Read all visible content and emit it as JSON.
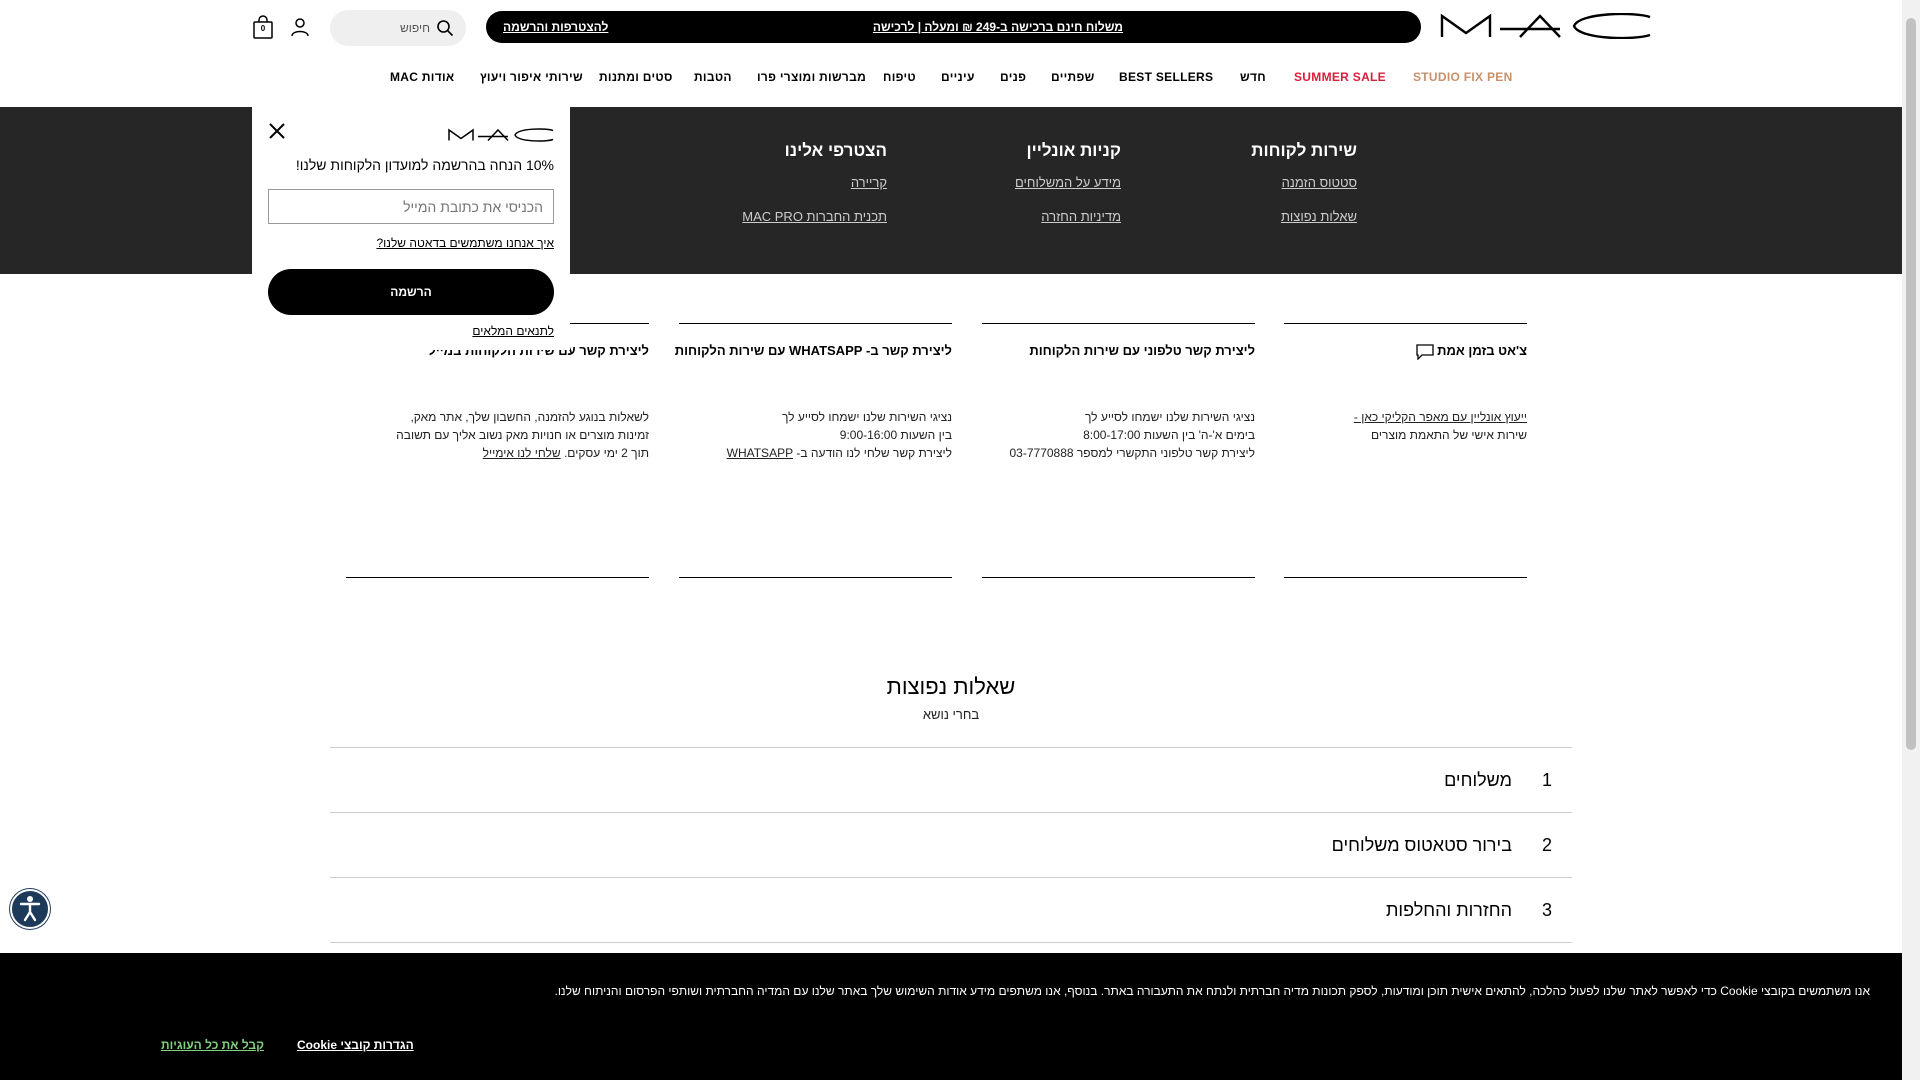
{
  "header": {
    "logo_text": "MAC",
    "promo_text": "משלוח חינם ברכישה ב-249 ₪ ומעלה | לרכישה",
    "promo_join": "להצטרפות והרשמה",
    "search_placeholder": "חיפוש",
    "bag_count": "0"
  },
  "nav": {
    "items": [
      "STUDIO FIX PEN",
      "SUMMER SALE",
      "חדש",
      "BEST SELLERS",
      "שפתיים",
      "פנים",
      "עיניים",
      "טיפוח",
      "מברשות ומוצרי פרו",
      "הטבות",
      "סטים ומתנות",
      "שירותי איפור ויעוץ",
      "אודות MAC"
    ]
  },
  "footer_links": {
    "columns": [
      {
        "title": "שירות לקוחות",
        "links": [
          "סטטוס הזמנה",
          "שאלות נפוצות"
        ]
      },
      {
        "title": "קניות אונליין",
        "links": [
          "מידע על המשלוחים",
          "מדיניות החזרה"
        ]
      },
      {
        "title": "הצטרפי אלינו",
        "links": [
          "קריירה",
          "תכנית החברות MAC PRO"
        ]
      }
    ]
  },
  "popup": {
    "title": "10% הנחה בהרשמה למועדון הלקוחות שלנו!",
    "email_placeholder": "הכניסי את כתובת המייל",
    "data_link": "איך אנחנו משתמשים בדאטה שלנו?",
    "submit": "הרשמה",
    "terms": "לתנאים המלאים"
  },
  "contact": {
    "cards": [
      {
        "title": "צ'אט בזמן אמת",
        "lines": [
          "ייעוץ אונליין עם מאפר הקליקי כאן -",
          "שירות אישי של התאמת מוצרים"
        ]
      },
      {
        "title": "ליצירת קשר טלפוני עם שירות הלקוחות",
        "lines": [
          "נציגי השירות שלנו ישמחו לסייע לך",
          "בימים א'-ה' בין השעות 8:00-17:00",
          "ליצירת קשר טלפוני התקשרי למספר 03-7770888"
        ]
      },
      {
        "title": "ליצירת קשר ב- WHATSAPP עם שירות הלקוחות",
        "lines": [
          "נציגי השירות שלנו ישמחו לסייע לך",
          "בין השעות 9:00-16:00",
          "ליצירת קשר שלחי לנו הודעה ב-",
          "WHATSAPP"
        ]
      },
      {
        "title": "ליצירת קשר עם שירות הלקוחות במייל",
        "lines": [
          "לשאלות בנוגע להזמנה, החשבון שלך, אתר מאק,",
          "זמינות מוצרים או חנויות מאק נשוב אליך עם תשובה",
          "תוך 2 ימי עסקים.",
          "שלחי לנו אימייל"
        ]
      }
    ]
  },
  "faq": {
    "title": "שאלות נפוצות",
    "subtitle": "בחרי נושא",
    "items": [
      {
        "num": "1",
        "label": "משלוחים"
      },
      {
        "num": "2",
        "label": "בירור סטאטוס משלוחים"
      },
      {
        "num": "3",
        "label": "החזרות והחלפות"
      }
    ]
  },
  "cookie": {
    "message": "אנו משתמשים בקובצי Cookie כדי לאפשר לאתר שלנו לפעול כהלכה, להתאים אישית תוכן ומודעות, לספק תכונות מדיה חברתית ולנתח את התעבורה באתר. בנוסף, אנו משתפים מידע אודות השימוש שלך באתר שלנו עם המדיה החברתית ושותפי הפרסום והניתוח שלנו.",
    "settings": "הגדרות קובצי Cookie",
    "accept": "קבל את כל העוגיות"
  },
  "colors": {
    "sale": "#d6203b",
    "fix": "#c8906b",
    "dark_band": "#262626"
  }
}
